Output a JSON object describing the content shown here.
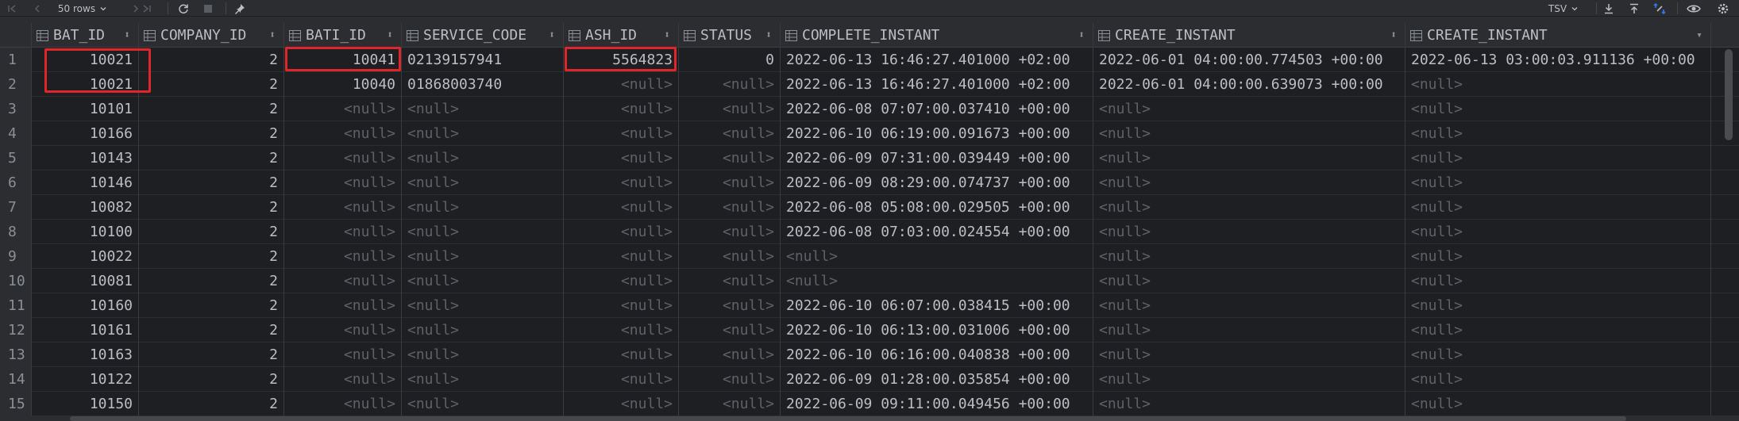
{
  "toolbar": {
    "rows_label": "50 rows",
    "format_label": "TSV"
  },
  "columns": [
    {
      "name": "BAT_ID",
      "sort": "⬍"
    },
    {
      "name": "COMPANY_ID",
      "sort": "⬍"
    },
    {
      "name": "BATI_ID",
      "sort": "⬍"
    },
    {
      "name": "SERVICE_CODE",
      "sort": "⬍"
    },
    {
      "name": "ASH_ID",
      "sort": "⬍"
    },
    {
      "name": "STATUS",
      "sort": "⬍"
    },
    {
      "name": "COMPLETE_INSTANT",
      "sort": "⬍"
    },
    {
      "name": "CREATE_INSTANT",
      "sort": "⬍"
    },
    {
      "name": "CREATE_INSTANT",
      "sort": "▾"
    }
  ],
  "rows": [
    {
      "n": "1",
      "c": [
        "10021",
        "2",
        "10041",
        "02139157941",
        "5564823",
        "0",
        "2022-06-13 16:46:27.401000 +02:00",
        "2022-06-01 04:00:00.774503 +00:00",
        "2022-06-13 03:00:03.911136 +00:00"
      ]
    },
    {
      "n": "2",
      "c": [
        "10021",
        "2",
        "10040",
        "01868003740",
        "<null>",
        "<null>",
        "2022-06-13 16:46:27.401000 +02:00",
        "2022-06-01 04:00:00.639073 +00:00",
        "<null>"
      ]
    },
    {
      "n": "3",
      "c": [
        "10101",
        "2",
        "<null>",
        "<null>",
        "<null>",
        "<null>",
        "2022-06-08 07:07:00.037410 +00:00",
        "<null>",
        "<null>"
      ]
    },
    {
      "n": "4",
      "c": [
        "10166",
        "2",
        "<null>",
        "<null>",
        "<null>",
        "<null>",
        "2022-06-10 06:19:00.091673 +00:00",
        "<null>",
        "<null>"
      ]
    },
    {
      "n": "5",
      "c": [
        "10143",
        "2",
        "<null>",
        "<null>",
        "<null>",
        "<null>",
        "2022-06-09 07:31:00.039449 +00:00",
        "<null>",
        "<null>"
      ]
    },
    {
      "n": "6",
      "c": [
        "10146",
        "2",
        "<null>",
        "<null>",
        "<null>",
        "<null>",
        "2022-06-09 08:29:00.074737 +00:00",
        "<null>",
        "<null>"
      ]
    },
    {
      "n": "7",
      "c": [
        "10082",
        "2",
        "<null>",
        "<null>",
        "<null>",
        "<null>",
        "2022-06-08 05:08:00.029505 +00:00",
        "<null>",
        "<null>"
      ]
    },
    {
      "n": "8",
      "c": [
        "10100",
        "2",
        "<null>",
        "<null>",
        "<null>",
        "<null>",
        "2022-06-08 07:03:00.024554 +00:00",
        "<null>",
        "<null>"
      ]
    },
    {
      "n": "9",
      "c": [
        "10022",
        "2",
        "<null>",
        "<null>",
        "<null>",
        "<null>",
        "<null>",
        "<null>",
        "<null>"
      ]
    },
    {
      "n": "10",
      "c": [
        "10081",
        "2",
        "<null>",
        "<null>",
        "<null>",
        "<null>",
        "<null>",
        "<null>",
        "<null>"
      ]
    },
    {
      "n": "11",
      "c": [
        "10160",
        "2",
        "<null>",
        "<null>",
        "<null>",
        "<null>",
        "2022-06-10 06:07:00.038415 +00:00",
        "<null>",
        "<null>"
      ]
    },
    {
      "n": "12",
      "c": [
        "10161",
        "2",
        "<null>",
        "<null>",
        "<null>",
        "<null>",
        "2022-06-10 06:13:00.031006 +00:00",
        "<null>",
        "<null>"
      ]
    },
    {
      "n": "13",
      "c": [
        "10163",
        "2",
        "<null>",
        "<null>",
        "<null>",
        "<null>",
        "2022-06-10 06:16:00.040838 +00:00",
        "<null>",
        "<null>"
      ]
    },
    {
      "n": "14",
      "c": [
        "10122",
        "2",
        "<null>",
        "<null>",
        "<null>",
        "<null>",
        "2022-06-09 01:28:00.035854 +00:00",
        "<null>",
        "<null>"
      ]
    },
    {
      "n": "15",
      "c": [
        "10150",
        "2",
        "<null>",
        "<null>",
        "<null>",
        "<null>",
        "2022-06-09 09:11:00.049456 +00:00",
        "<null>",
        "<null>"
      ]
    }
  ],
  "colors": {
    "highlight": "#e0252b",
    "accent": "#3574f0"
  }
}
